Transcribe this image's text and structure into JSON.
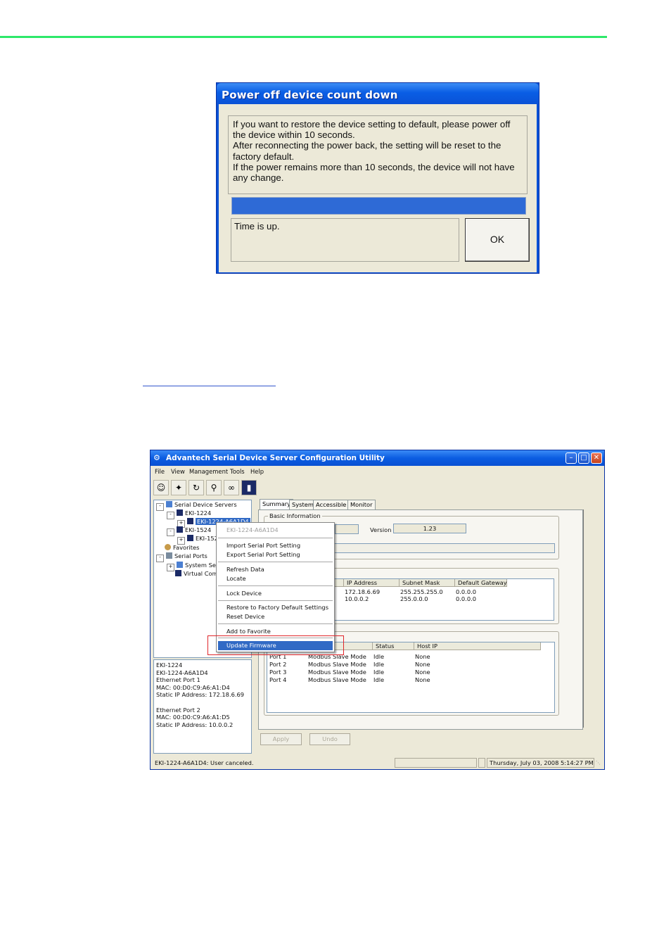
{
  "dialog": {
    "title": "Power off device count down",
    "message_lines": [
      "If you want to restore the device setting to default, please power off",
      "the device within 10 seconds.",
      "After reconnecting the power back, the setting will be reset to the",
      "factory default.",
      "If the power remains more than 10 seconds, the device will not have",
      "any change."
    ],
    "progress": 1.0,
    "status": "Time is up.",
    "ok_label": "OK"
  },
  "app": {
    "title": "Advantech Serial Device Server Configuration Utility",
    "menu": [
      "File",
      "View",
      "Management",
      "Tools",
      "Help"
    ],
    "toolbar_icons": [
      "users-icon",
      "wand-icon",
      "refresh-icon",
      "search-icon",
      "binoculars-icon",
      "device-icon"
    ],
    "tree": {
      "root": "Serial Device Servers",
      "eki1224": "EKI-1224",
      "eki1224_child": "EKI-1224-A6A1D4",
      "eki1524": "EKI-1524",
      "eki1524_child": "EKI-152",
      "favorites": "Favorites",
      "serial_ports": "Serial Ports",
      "system_ser": "System Ser",
      "virtual_com": "Virtual Com"
    },
    "info_lines": [
      "EKI-1224",
      "EKI-1224-A6A1D4",
      "Ethernet Port 1",
      "MAC: 00:D0:C9:A6:A1:D4",
      "Static IP Address: 172.18.6.69",
      "",
      "Ethernet Port 2",
      "MAC: 00:D0:C9:A6:A1:D5",
      "Static IP Address: 10.0.0.2"
    ],
    "tabs": [
      "Summary",
      "System",
      "Accessible",
      "Monitor"
    ],
    "basic_info_label": "Basic Information",
    "version_label": "Version",
    "version_value": "1.23",
    "net_headers": [
      "IP Address",
      "Subnet Mask",
      "Default Gateway"
    ],
    "net_rows": [
      [
        "172.18.6.69",
        "255.255.255.0",
        "0.0.0.0"
      ],
      [
        "10.0.0.2",
        "255.0.0.0",
        "0.0.0.0"
      ]
    ],
    "port_headers": [
      "Status",
      "Host IP"
    ],
    "port_rows": [
      [
        "Port 1",
        "Modbus Slave Mode",
        "Idle",
        "None"
      ],
      [
        "Port 2",
        "Modbus Slave Mode",
        "Idle",
        "None"
      ],
      [
        "Port 3",
        "Modbus Slave Mode",
        "Idle",
        "None"
      ],
      [
        "Port 4",
        "Modbus Slave Mode",
        "Idle",
        "None"
      ]
    ],
    "apply_label": "Apply",
    "undo_label": "Undo",
    "status_text": "EKI-1224-A6A1D4: User canceled.",
    "status_datetime": "Thursday, July 03, 2008 5:14:27 PM"
  },
  "context_menu": {
    "header": "EKI-1224-A6A1D4",
    "import": "Import Serial Port Setting",
    "export": "Export Serial Port Setting",
    "refresh": "Refresh Data",
    "locate": "Locate",
    "lock": "Lock Device",
    "restore": "Restore to Factory Default Settings",
    "reset": "Reset Device",
    "favorite": "Add to Favorite",
    "update": "Update Firmware"
  },
  "colors": {
    "rule": "#2ee86a",
    "title_blue": "#0a52d6",
    "highlight": "#316ac5",
    "callout_red": "#e0262b"
  }
}
